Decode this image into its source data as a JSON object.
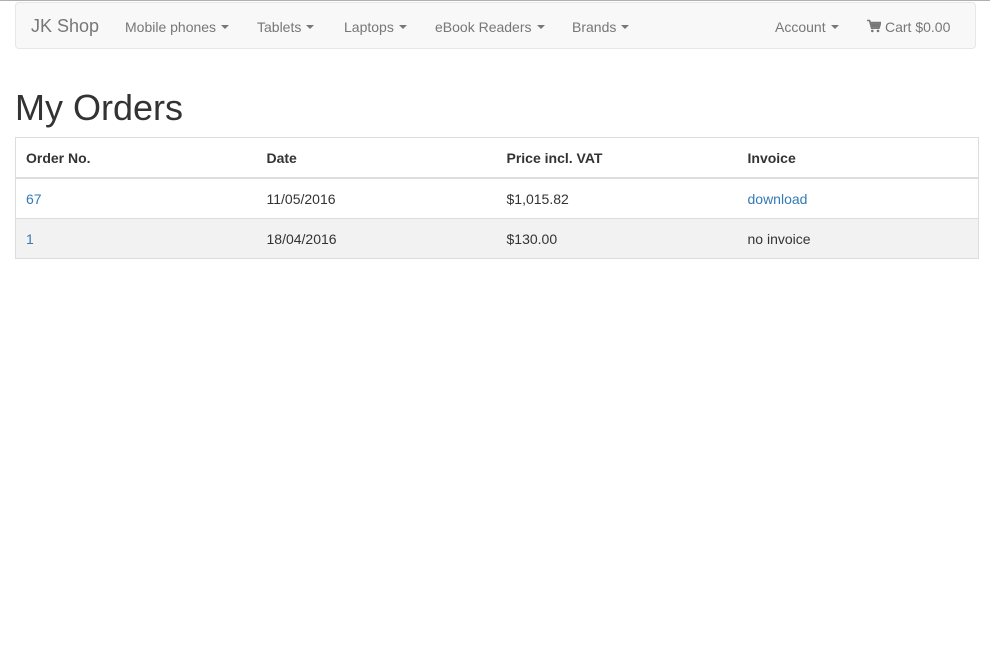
{
  "navbar": {
    "brand": "JK Shop",
    "menus": [
      {
        "label": "Mobile phones"
      },
      {
        "label": "Tablets"
      },
      {
        "label": "Laptops"
      },
      {
        "label": "eBook Readers"
      },
      {
        "label": "Brands"
      }
    ],
    "account_label": "Account",
    "cart_label": "Cart $0.00"
  },
  "page": {
    "title": "My Orders"
  },
  "orders_table": {
    "headers": [
      "Order No.",
      "Date",
      "Price incl. VAT",
      "Invoice"
    ],
    "rows": [
      {
        "order_no": "67",
        "date": "11/05/2016",
        "price": "$1,015.82",
        "invoice": "download"
      },
      {
        "order_no": "1",
        "date": "18/04/2016",
        "price": "$130.00",
        "invoice": "no invoice"
      }
    ]
  },
  "colors": {
    "link": "#337ab7",
    "navbar_bg": "#f8f8f8",
    "nav_text": "#777777",
    "row_alt_bg": "#f2f2f2"
  },
  "icons": {
    "cart": "shopping-cart-icon",
    "dropdown": "caret-down-icon"
  }
}
